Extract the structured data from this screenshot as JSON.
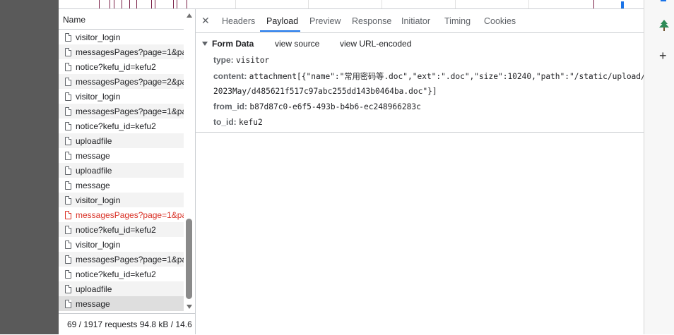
{
  "requests": {
    "column_header": "Name",
    "items": [
      {
        "name": "visitor_login",
        "status": "ok"
      },
      {
        "name": "messagesPages?page=1&pa",
        "status": "ok"
      },
      {
        "name": "notice?kefu_id=kefu2",
        "status": "ok"
      },
      {
        "name": "messagesPages?page=2&pa",
        "status": "ok"
      },
      {
        "name": "visitor_login",
        "status": "ok"
      },
      {
        "name": "messagesPages?page=1&pa",
        "status": "ok"
      },
      {
        "name": "notice?kefu_id=kefu2",
        "status": "ok"
      },
      {
        "name": "uploadfile",
        "status": "ok"
      },
      {
        "name": "message",
        "status": "ok"
      },
      {
        "name": "uploadfile",
        "status": "ok"
      },
      {
        "name": "message",
        "status": "ok"
      },
      {
        "name": "visitor_login",
        "status": "ok"
      },
      {
        "name": "messagesPages?page=1&pa",
        "status": "error"
      },
      {
        "name": "notice?kefu_id=kefu2",
        "status": "ok"
      },
      {
        "name": "visitor_login",
        "status": "ok"
      },
      {
        "name": "messagesPages?page=1&pa",
        "status": "ok"
      },
      {
        "name": "notice?kefu_id=kefu2",
        "status": "ok"
      },
      {
        "name": "uploadfile",
        "status": "ok"
      },
      {
        "name": "message",
        "status": "selected"
      }
    ],
    "footer": "69 / 1917 requests  94.8 kB / 14.6"
  },
  "tabs": {
    "close_label": "✕",
    "labels": [
      "Headers",
      "Payload",
      "Preview",
      "Response",
      "Initiator",
      "Timing",
      "Cookies"
    ],
    "active": "Payload"
  },
  "payload": {
    "section_title": "Form Data",
    "view_source": "view source",
    "view_url_encoded": "view URL-encoded",
    "fields": [
      {
        "key": "type:",
        "value": "visitor"
      },
      {
        "key": "content:",
        "value": "attachment[{\"name\":\"常用密码等.doc\",\"ext\":\".doc\",\"size\":10240,\"path\":\"/static/upload/",
        "cont": "2023May/d485621f517c97abc255dd143b0464ba.doc\"}]"
      },
      {
        "key": "from_id:",
        "value": "b87d87c0-e6f5-493b-b4b6-ec248966283c"
      },
      {
        "key": "to_id:",
        "value": "kefu2"
      }
    ]
  },
  "sidebar_right": {
    "icons": [
      "tree-icon",
      "plus-icon"
    ],
    "plus_label": "+"
  },
  "colors": {
    "accent": "#1a73e8",
    "error": "#d93025",
    "tree": "#2e8b57"
  }
}
